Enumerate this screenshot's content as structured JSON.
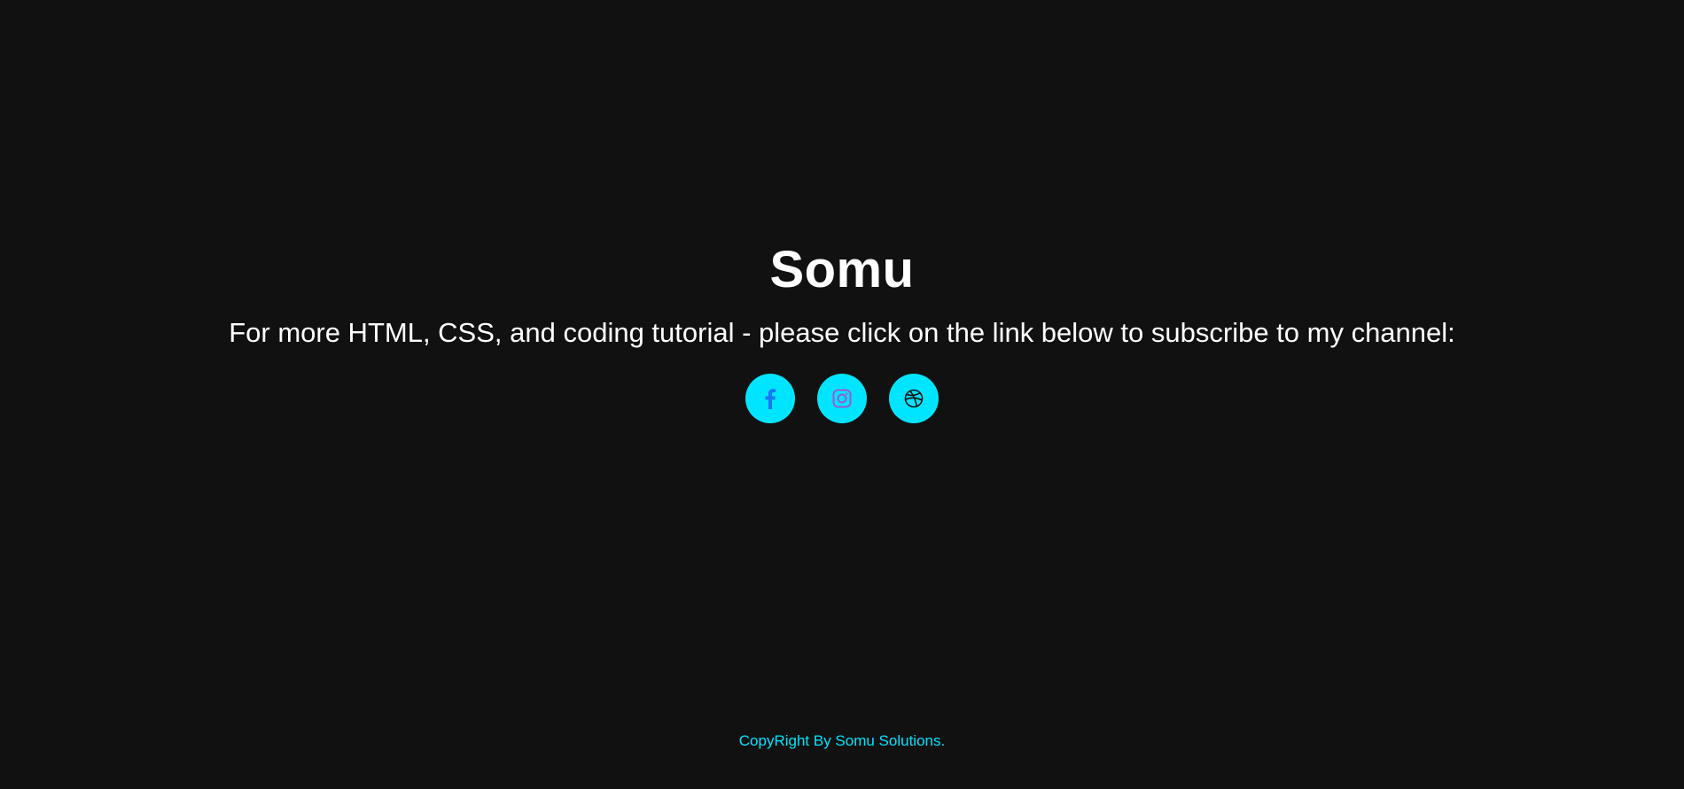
{
  "hero": {
    "title": "Somu",
    "tagline": "For more HTML, CSS, and coding tutorial - please click on the link below to subscribe to my channel:"
  },
  "socials": [
    {
      "name": "facebook",
      "icon": "facebook-icon"
    },
    {
      "name": "instagram",
      "icon": "instagram-icon"
    },
    {
      "name": "dribbble",
      "icon": "dribbble-icon"
    }
  ],
  "footer": {
    "text": "CopyRight By Somu Solutions."
  },
  "colors": {
    "background": "#111111",
    "accent": "#00e5ff",
    "facebook_icon": "#1877f2",
    "instagram_icon": "#9b59d0",
    "dribbble_icon": "#111111",
    "text": "#ffffff"
  }
}
